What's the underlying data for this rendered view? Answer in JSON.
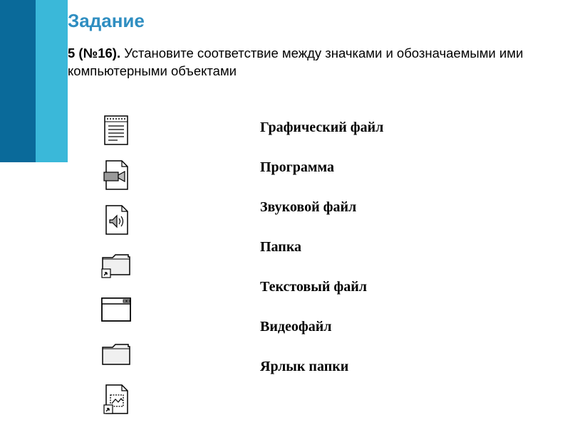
{
  "title": "Задание",
  "instruction": {
    "prefix": "5 (№16).",
    "text": " Установите соответствие между значками и обозначаемыми ими компьютерными объектами"
  },
  "icons": [
    {
      "name": "text-file-icon"
    },
    {
      "name": "video-file-icon"
    },
    {
      "name": "audio-file-icon"
    },
    {
      "name": "folder-shortcut-icon"
    },
    {
      "name": "program-window-icon"
    },
    {
      "name": "folder-icon"
    },
    {
      "name": "image-file-shortcut-icon"
    }
  ],
  "labels": [
    "Графический файл",
    "Программа",
    "Звуковой файл",
    "Папка",
    "Текстовый файл",
    "Видеофайл",
    "Ярлык папки"
  ]
}
